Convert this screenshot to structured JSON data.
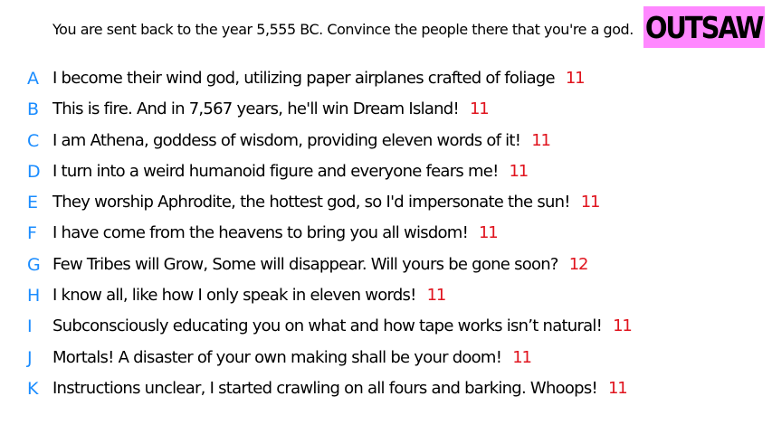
{
  "prompt": "You are sent back to the year 5,555 BC. Convince the people there that you're a god.",
  "badge": "OUTSAW",
  "colors": {
    "letter": "#1a8cff",
    "count": "#e0141e",
    "badge_bg": "#ff88ff"
  },
  "entries": [
    {
      "letter": "A",
      "text": "I become their wind god, utilizing paper airplanes crafted of foliage",
      "count": "11"
    },
    {
      "letter": "B",
      "text": "This is fire. And in 7,567 years, he'll win Dream Island!",
      "count": "11"
    },
    {
      "letter": "C",
      "text": "I am Athena, goddess of wisdom, providing eleven words of it!",
      "count": "11"
    },
    {
      "letter": "D",
      "text": "I turn into a weird humanoid figure and everyone fears me!",
      "count": "11"
    },
    {
      "letter": "E",
      "text": "They worship Aphrodite, the hottest god, so I'd impersonate the sun!",
      "count": "11"
    },
    {
      "letter": "F",
      "text": "I have come from the heavens to bring you all wisdom!",
      "count": "11"
    },
    {
      "letter": "G",
      "text": "Few Tribes will Grow, Some will disappear. Will yours be gone soon?",
      "count": "12"
    },
    {
      "letter": "H",
      "text": "I know all, like how I only speak in eleven words!",
      "count": "11"
    },
    {
      "letter": "I",
      "text": "Subconsciously educating you on what and how tape works isn’t natural!",
      "count": "11"
    },
    {
      "letter": "J",
      "text": "Mortals! A disaster of your own making shall be your doom!",
      "count": "11"
    },
    {
      "letter": "K",
      "text": "Instructions unclear, I started crawling on all fours and barking. Whoops!",
      "count": "11"
    }
  ]
}
